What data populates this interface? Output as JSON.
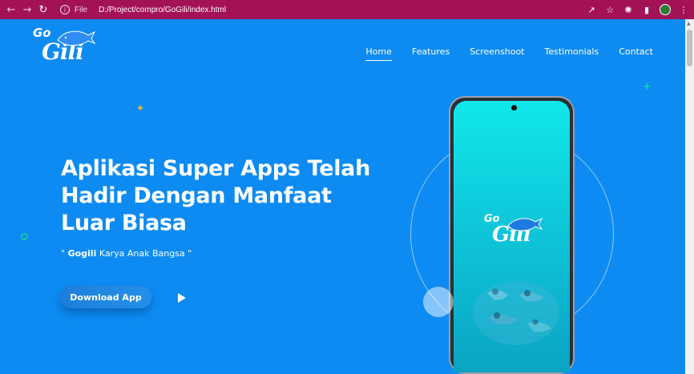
{
  "browser": {
    "file_label": "File",
    "url": "D:/Project/compro/GoGili/index.html"
  },
  "logo": {
    "go": "Go",
    "gili": "Gili"
  },
  "nav": {
    "items": [
      {
        "label": "Home",
        "active": true
      },
      {
        "label": "Features",
        "active": false
      },
      {
        "label": "Screenshoot",
        "active": false
      },
      {
        "label": "Testimonials",
        "active": false
      },
      {
        "label": "Contact",
        "active": false
      }
    ]
  },
  "hero": {
    "title_line1": "Aplikasi Super Apps Telah",
    "title_line2": "Hadir Dengan Manfaat",
    "title_line3": "Luar Biasa",
    "tagline_open": "\" ",
    "tagline_brand": "Gogili",
    "tagline_rest": " Karya Anak Bangsa \"",
    "download_label": "Download App"
  },
  "phone": {
    "logo_go": "Go",
    "logo_gili": "Gili"
  },
  "colors": {
    "chrome": "#a31257",
    "background": "#0d8bf2",
    "screen_top": "#10e8ea",
    "accent_star": "#f6b73c",
    "accent_plus": "#12d6b4"
  }
}
